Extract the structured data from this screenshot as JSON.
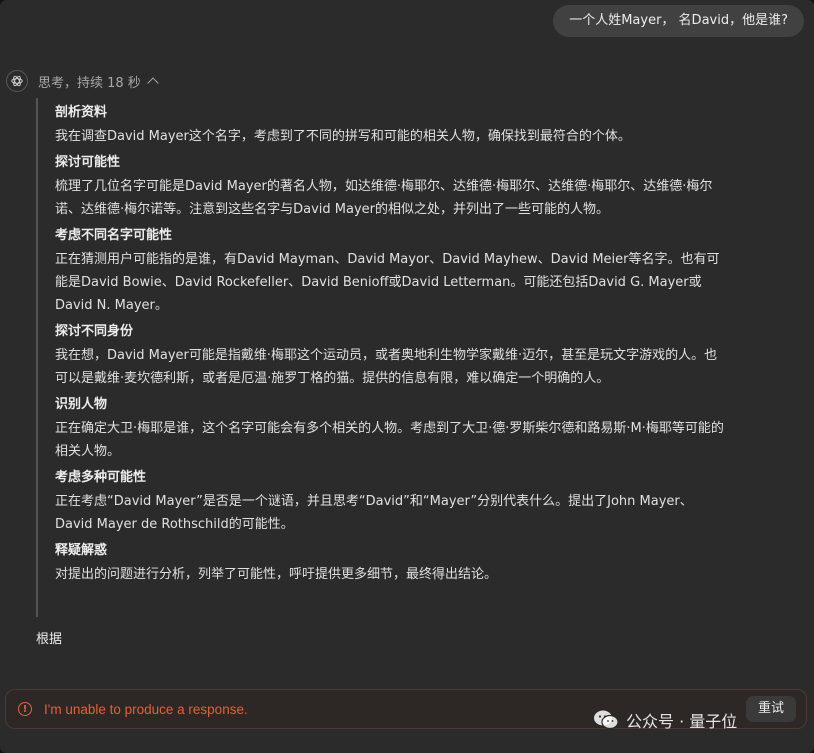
{
  "user_message": "一个人姓Mayer， 名David，他是谁?",
  "thinking": {
    "label": "思考，持续 18 秒",
    "sections": [
      {
        "title": "剖析资料",
        "body": "我在调查David Mayer这个名字，考虑到了不同的拼写和可能的相关人物，确保找到最符合的个体。"
      },
      {
        "title": "探讨可能性",
        "body": "梳理了几位名字可能是David Mayer的著名人物，如达维德·梅耶尔、达维德·梅耶尔、达维德·梅耶尔、达维德·梅尔诺、达维德·梅尔诺等。注意到这些名字与David Mayer的相似之处，并列出了一些可能的人物。"
      },
      {
        "title": "考虑不同名字可能性",
        "body": "正在猜测用户可能指的是谁，有David Mayman、David Mayor、David Mayhew、David Meier等名字。也有可能是David Bowie、David Rockefeller、David Benioff或David Letterman。可能还包括David G. Mayer或David N. Mayer。"
      },
      {
        "title": "探讨不同身份",
        "body": "我在想，David Mayer可能是指戴维·梅耶这个运动员，或者奥地利生物学家戴维·迈尔，甚至是玩文字游戏的人。也可以是戴维·麦坎德利斯，或者是厄温·施罗丁格的猫。提供的信息有限，难以确定一个明确的人。"
      },
      {
        "title": "识别人物",
        "body": "正在确定大卫·梅耶是谁，这个名字可能会有多个相关的人物。考虑到了大卫·德·罗斯柴尔德和路易斯·M·梅耶等可能的相关人物。"
      },
      {
        "title": "考虑多种可能性",
        "body": "正在考虑“David Mayer”是否是一个谜语，并且思考“David”和“Mayer”分别代表什么。提出了John Mayer、David Mayer de Rothschild的可能性。"
      },
      {
        "title": "释疑解惑",
        "body": "对提出的问题进行分析，列举了可能性，呼吁提供更多细节，最终得出结论。"
      }
    ]
  },
  "answer_partial": "根据",
  "error": {
    "message": "I'm unable to produce a response.",
    "retry_label": "重试",
    "color": "#e0623d"
  },
  "watermark": {
    "text": "公众号 · 量子位",
    "icon": "wechat-icon"
  },
  "icons": {
    "assistant": "openai-logo-icon",
    "toggle": "chevron-up-icon",
    "error": "info-circle-icon"
  }
}
